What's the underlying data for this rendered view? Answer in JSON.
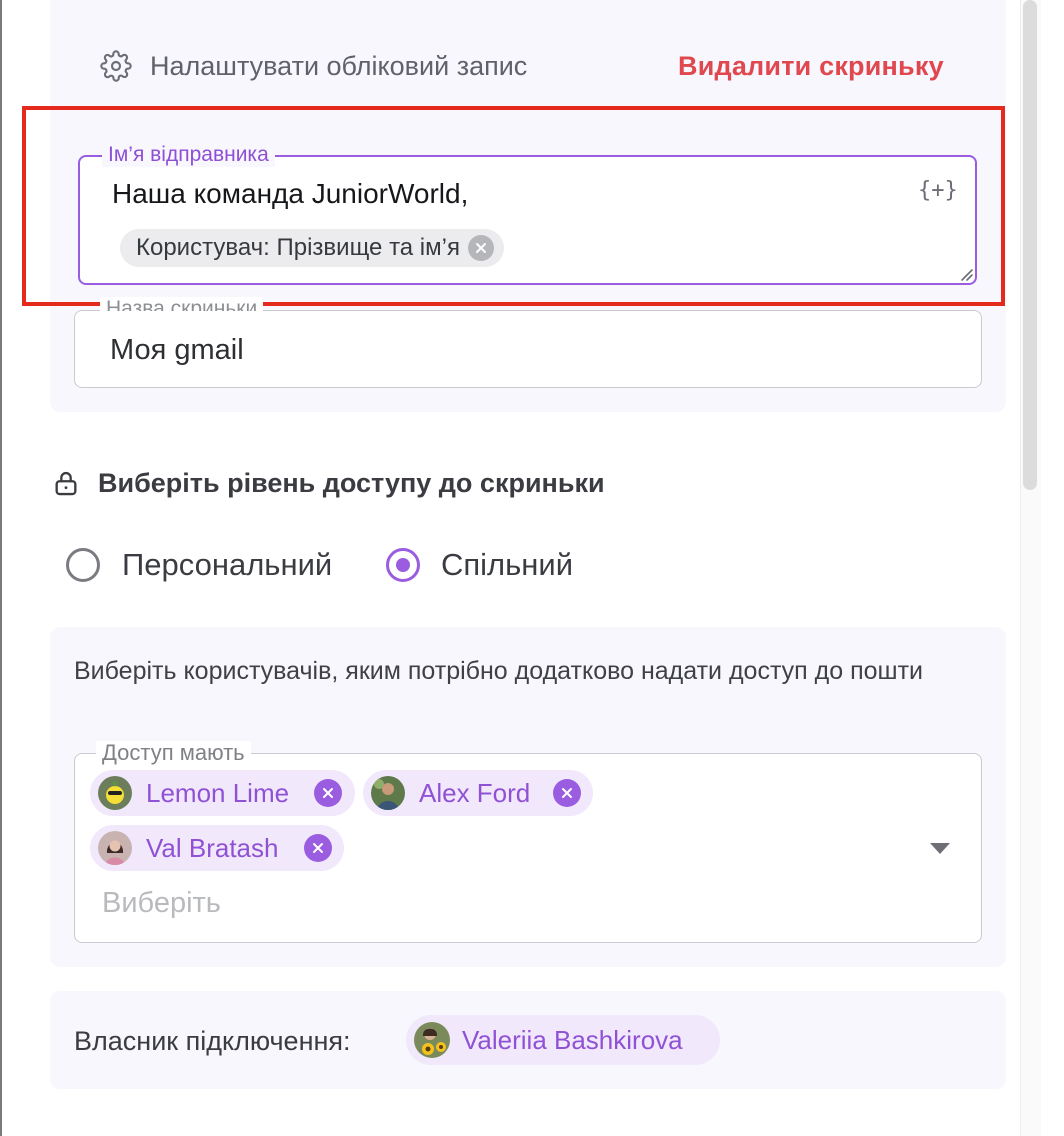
{
  "header": {
    "setup_link": "Налаштувати обліковий запис",
    "delete_link": "Видалити скриньку"
  },
  "sender_field": {
    "legend": "Ім’я відправника",
    "value": "Наша команда JuniorWorld,",
    "variable_icon": "{+}",
    "variable_chip": "Користувач: Прізвище та ім’я"
  },
  "box_name_field": {
    "legend": "Назва скриньки",
    "value": "Моя gmail"
  },
  "access": {
    "title": "Виберіть рівень доступу до скриньки",
    "options": [
      {
        "label": "Персональний",
        "selected": false
      },
      {
        "label": "Спільний",
        "selected": true
      }
    ]
  },
  "users": {
    "description": "Виберіть користувачів, яким потрібно додатково надати доступ до пошти",
    "legend": "Доступ мають",
    "chips": [
      {
        "name": "Lemon Lime"
      },
      {
        "name": "Alex Ford"
      },
      {
        "name": "Val Bratash"
      }
    ],
    "placeholder": "Виберіть"
  },
  "owner": {
    "label": "Власник підключення:",
    "name": "Valeriia Bashkirova"
  },
  "colors": {
    "accent": "#9b5de0",
    "danger": "#e0484f",
    "highlight_border": "#e32a1d",
    "panel_bg": "#f8f7fd",
    "chip_bg": "#f1e8fc"
  },
  "icons": [
    "gear-icon",
    "variable-insert-icon",
    "close-icon",
    "lock-icon",
    "chevron-down-icon",
    "resize-handle-icon"
  ]
}
